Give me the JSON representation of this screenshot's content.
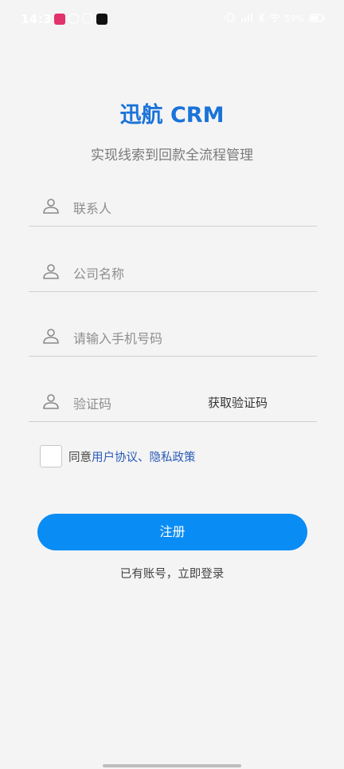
{
  "status_bar": {
    "time": "14:37",
    "battery": "59%"
  },
  "header": {
    "title": "迅航 CRM",
    "subtitle": "实现线索到回款全流程管理"
  },
  "form": {
    "contact_placeholder": "联系人",
    "company_placeholder": "公司名称",
    "phone_placeholder": "请输入手机号码",
    "code_placeholder": "验证码",
    "get_code_label": "获取验证码"
  },
  "agreement": {
    "prefix": "同意",
    "user_agreement": "用户协议",
    "separator": "、",
    "privacy_policy": "隐私政策"
  },
  "actions": {
    "register_label": "注册",
    "login_label": "已有账号，立即登录"
  },
  "colors": {
    "accent": "#0a8cf5",
    "title": "#1a73d8",
    "link": "#2a5ab5"
  }
}
